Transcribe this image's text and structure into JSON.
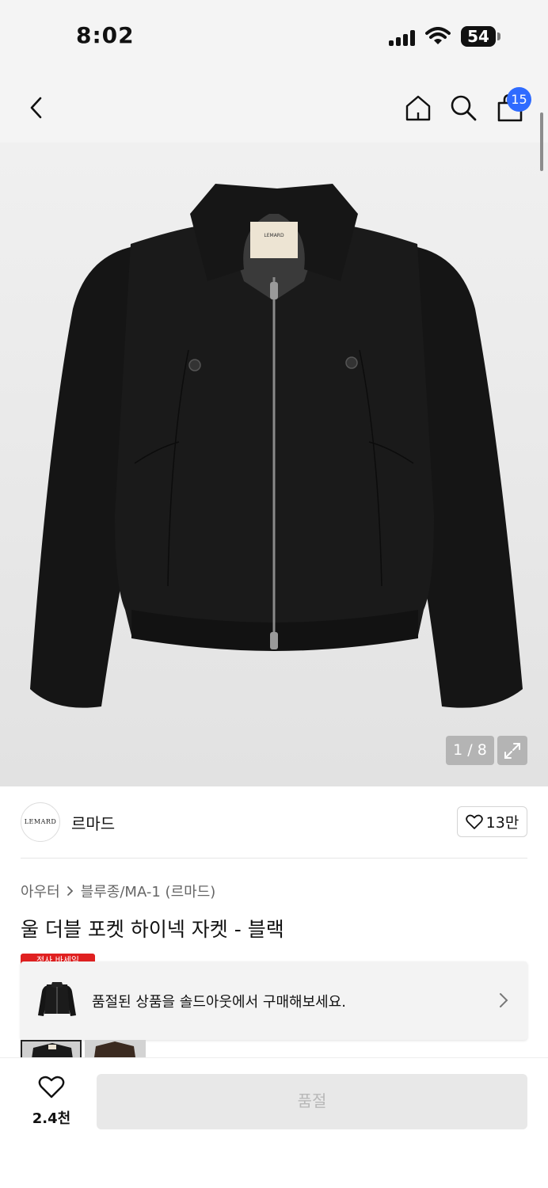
{
  "status_bar": {
    "time": "8:02",
    "battery": "54"
  },
  "nav": {
    "cart_count": "15"
  },
  "gallery": {
    "counter": "1 / 8",
    "label_text": "LEMARD"
  },
  "brand": {
    "logo_text": "LEMARD",
    "name": "르마드",
    "likes": "13만"
  },
  "breadcrumb": {
    "category": "아우터",
    "subcategory": "블루종/MA-1 (르마드)"
  },
  "product": {
    "title": "울 더블 포켓 하이넥 자켓 - 블랙",
    "sale_tag": "정사 바세일"
  },
  "soldout_banner": {
    "text": "품절된 상품을 솔드아웃에서 구매해보세요."
  },
  "bottom_bar": {
    "wish_count": "2.4천",
    "buy_label": "품절"
  },
  "colors": {
    "badge": "#2f6bff",
    "sale": "#e02020",
    "disabled": "#e8e8e8"
  },
  "icons": [
    "back-icon",
    "home-icon",
    "search-icon",
    "shopping-bag-icon",
    "expand-icon",
    "heart-icon",
    "chevron-right-icon"
  ]
}
